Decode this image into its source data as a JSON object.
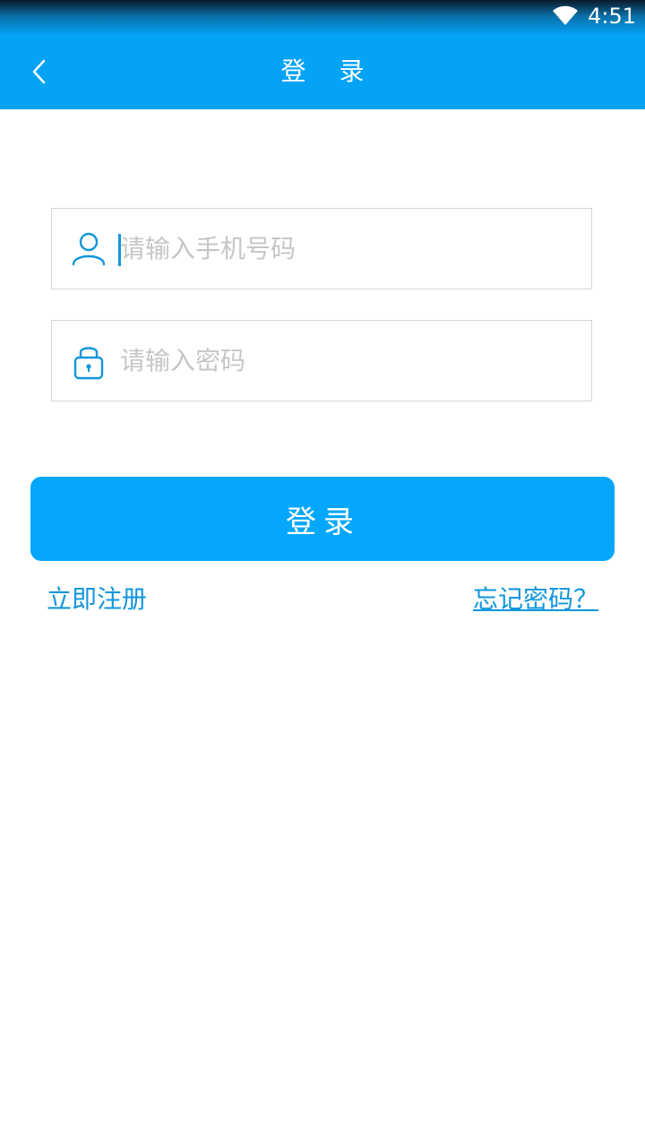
{
  "status_bar": {
    "time": "4:51",
    "icons": [
      "wifi-icon"
    ]
  },
  "app_bar": {
    "title": "登 录",
    "back_icon": "chevron-left-icon"
  },
  "form": {
    "phone_placeholder": "请输入手机号码",
    "phone_value": "",
    "phone_icon": "user-icon",
    "password_placeholder": "请输入密码",
    "password_value": "",
    "password_icon": "lock-icon"
  },
  "actions": {
    "login_label": "登录",
    "register_label": "立即注册",
    "forgot_label": "忘记密码？"
  },
  "colors": {
    "primary": "#04a3f6",
    "link": "#1296db",
    "placeholder": "#c6c6c6",
    "field_border": "#d6d6d6"
  }
}
